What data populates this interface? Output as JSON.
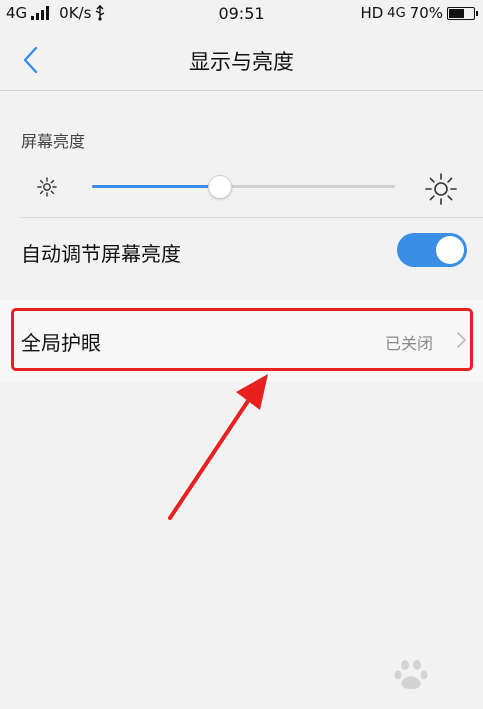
{
  "status_bar": {
    "network_left": "4G",
    "speed": "0K/s",
    "time": "09:51",
    "hd": "HD",
    "network_right": "4G",
    "battery_percent": "70%",
    "battery_level": 0.7
  },
  "header": {
    "title": "显示与亮度"
  },
  "brightness": {
    "section_label": "屏幕亮度",
    "level": 0.42
  },
  "auto_brightness": {
    "label": "自动调节屏幕亮度",
    "enabled": true
  },
  "eye_protection": {
    "label": "全局护眼",
    "value": "已关闭"
  },
  "colors": {
    "accent": "#3a8ee6",
    "highlight": "#e8201e"
  }
}
